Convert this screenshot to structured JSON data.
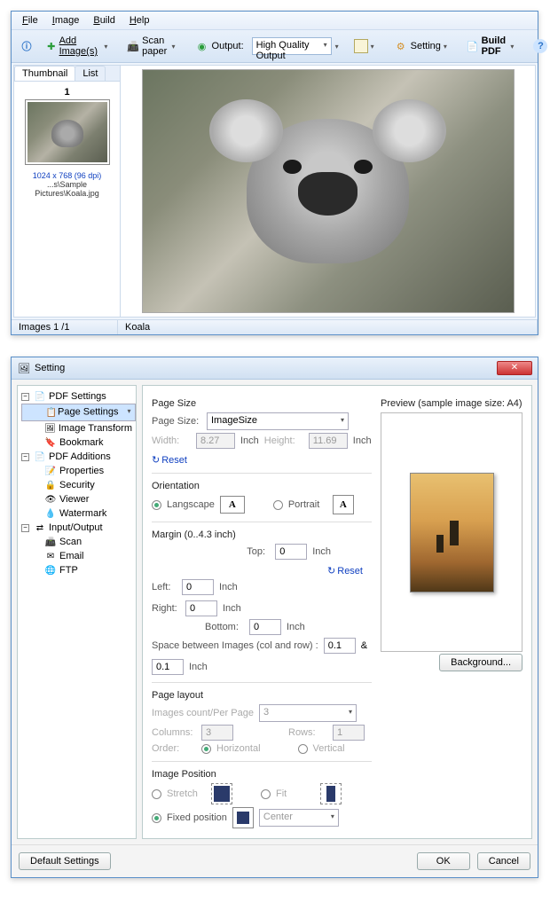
{
  "app": {
    "menus": [
      "File",
      "Image",
      "Build",
      "Help"
    ],
    "toolbar": {
      "add_images": "Add Image(s)",
      "scan_paper": "Scan paper",
      "output_label": "Output:",
      "output_value": "High Quality Output",
      "setting": "Setting",
      "build_pdf": "Build PDF"
    },
    "tabs": {
      "thumbnail": "Thumbnail",
      "list": "List"
    },
    "thumb": {
      "index": "1",
      "meta": "1024 x 768 (96 dpi)",
      "path": "...s\\Sample Pictures\\Koala.jpg"
    },
    "status": {
      "images": "Images 1 /1",
      "name": "Koala"
    }
  },
  "settings": {
    "title": "Setting",
    "tree": {
      "pdf_settings": "PDF Settings",
      "page_settings": "Page Settings",
      "image_transform": "Image Transform",
      "bookmark": "Bookmark",
      "pdf_additions": "PDF Additions",
      "properties": "Properties",
      "security": "Security",
      "viewer": "Viewer",
      "watermark": "Watermark",
      "input_output": "Input/Output",
      "scan": "Scan",
      "email": "Email",
      "ftp": "FTP"
    },
    "page_size": {
      "label": "Page Size",
      "page_size_label": "Page Size:",
      "page_size_value": "ImageSize",
      "width_label": "Width:",
      "width_value": "8.27",
      "height_label": "Height:",
      "height_value": "11.69",
      "inch": "Inch",
      "reset": "Reset"
    },
    "orientation": {
      "label": "Orientation",
      "landscape": "Langscape",
      "portrait": "Portrait"
    },
    "margin": {
      "label": "Margin (0..4.3 inch)",
      "top": "Top:",
      "left": "Left:",
      "right": "Right:",
      "bottom": "Bottom:",
      "top_v": "0",
      "left_v": "0",
      "right_v": "0",
      "bottom_v": "0",
      "space_label": "Space between Images (col and row) :",
      "col_v": "0.1",
      "amp": "&",
      "row_v": "0.1",
      "inch": "Inch",
      "reset": "Reset"
    },
    "layout": {
      "label": "Page layout",
      "count_label": "Images count/Per Page",
      "count_v": "3",
      "columns": "Columns:",
      "columns_v": "3",
      "rows": "Rows:",
      "rows_v": "1",
      "order": "Order:",
      "horizontal": "Horizontal",
      "vertical": "Vertical"
    },
    "position": {
      "label": "Image Position",
      "stretch": "Stretch",
      "fit": "Fit",
      "fixed": "Fixed position",
      "align_value": "Center"
    },
    "preview": {
      "label": "Preview (sample image size: A4)",
      "background": "Background..."
    },
    "footer": {
      "default": "Default Settings",
      "ok": "OK",
      "cancel": "Cancel"
    }
  }
}
